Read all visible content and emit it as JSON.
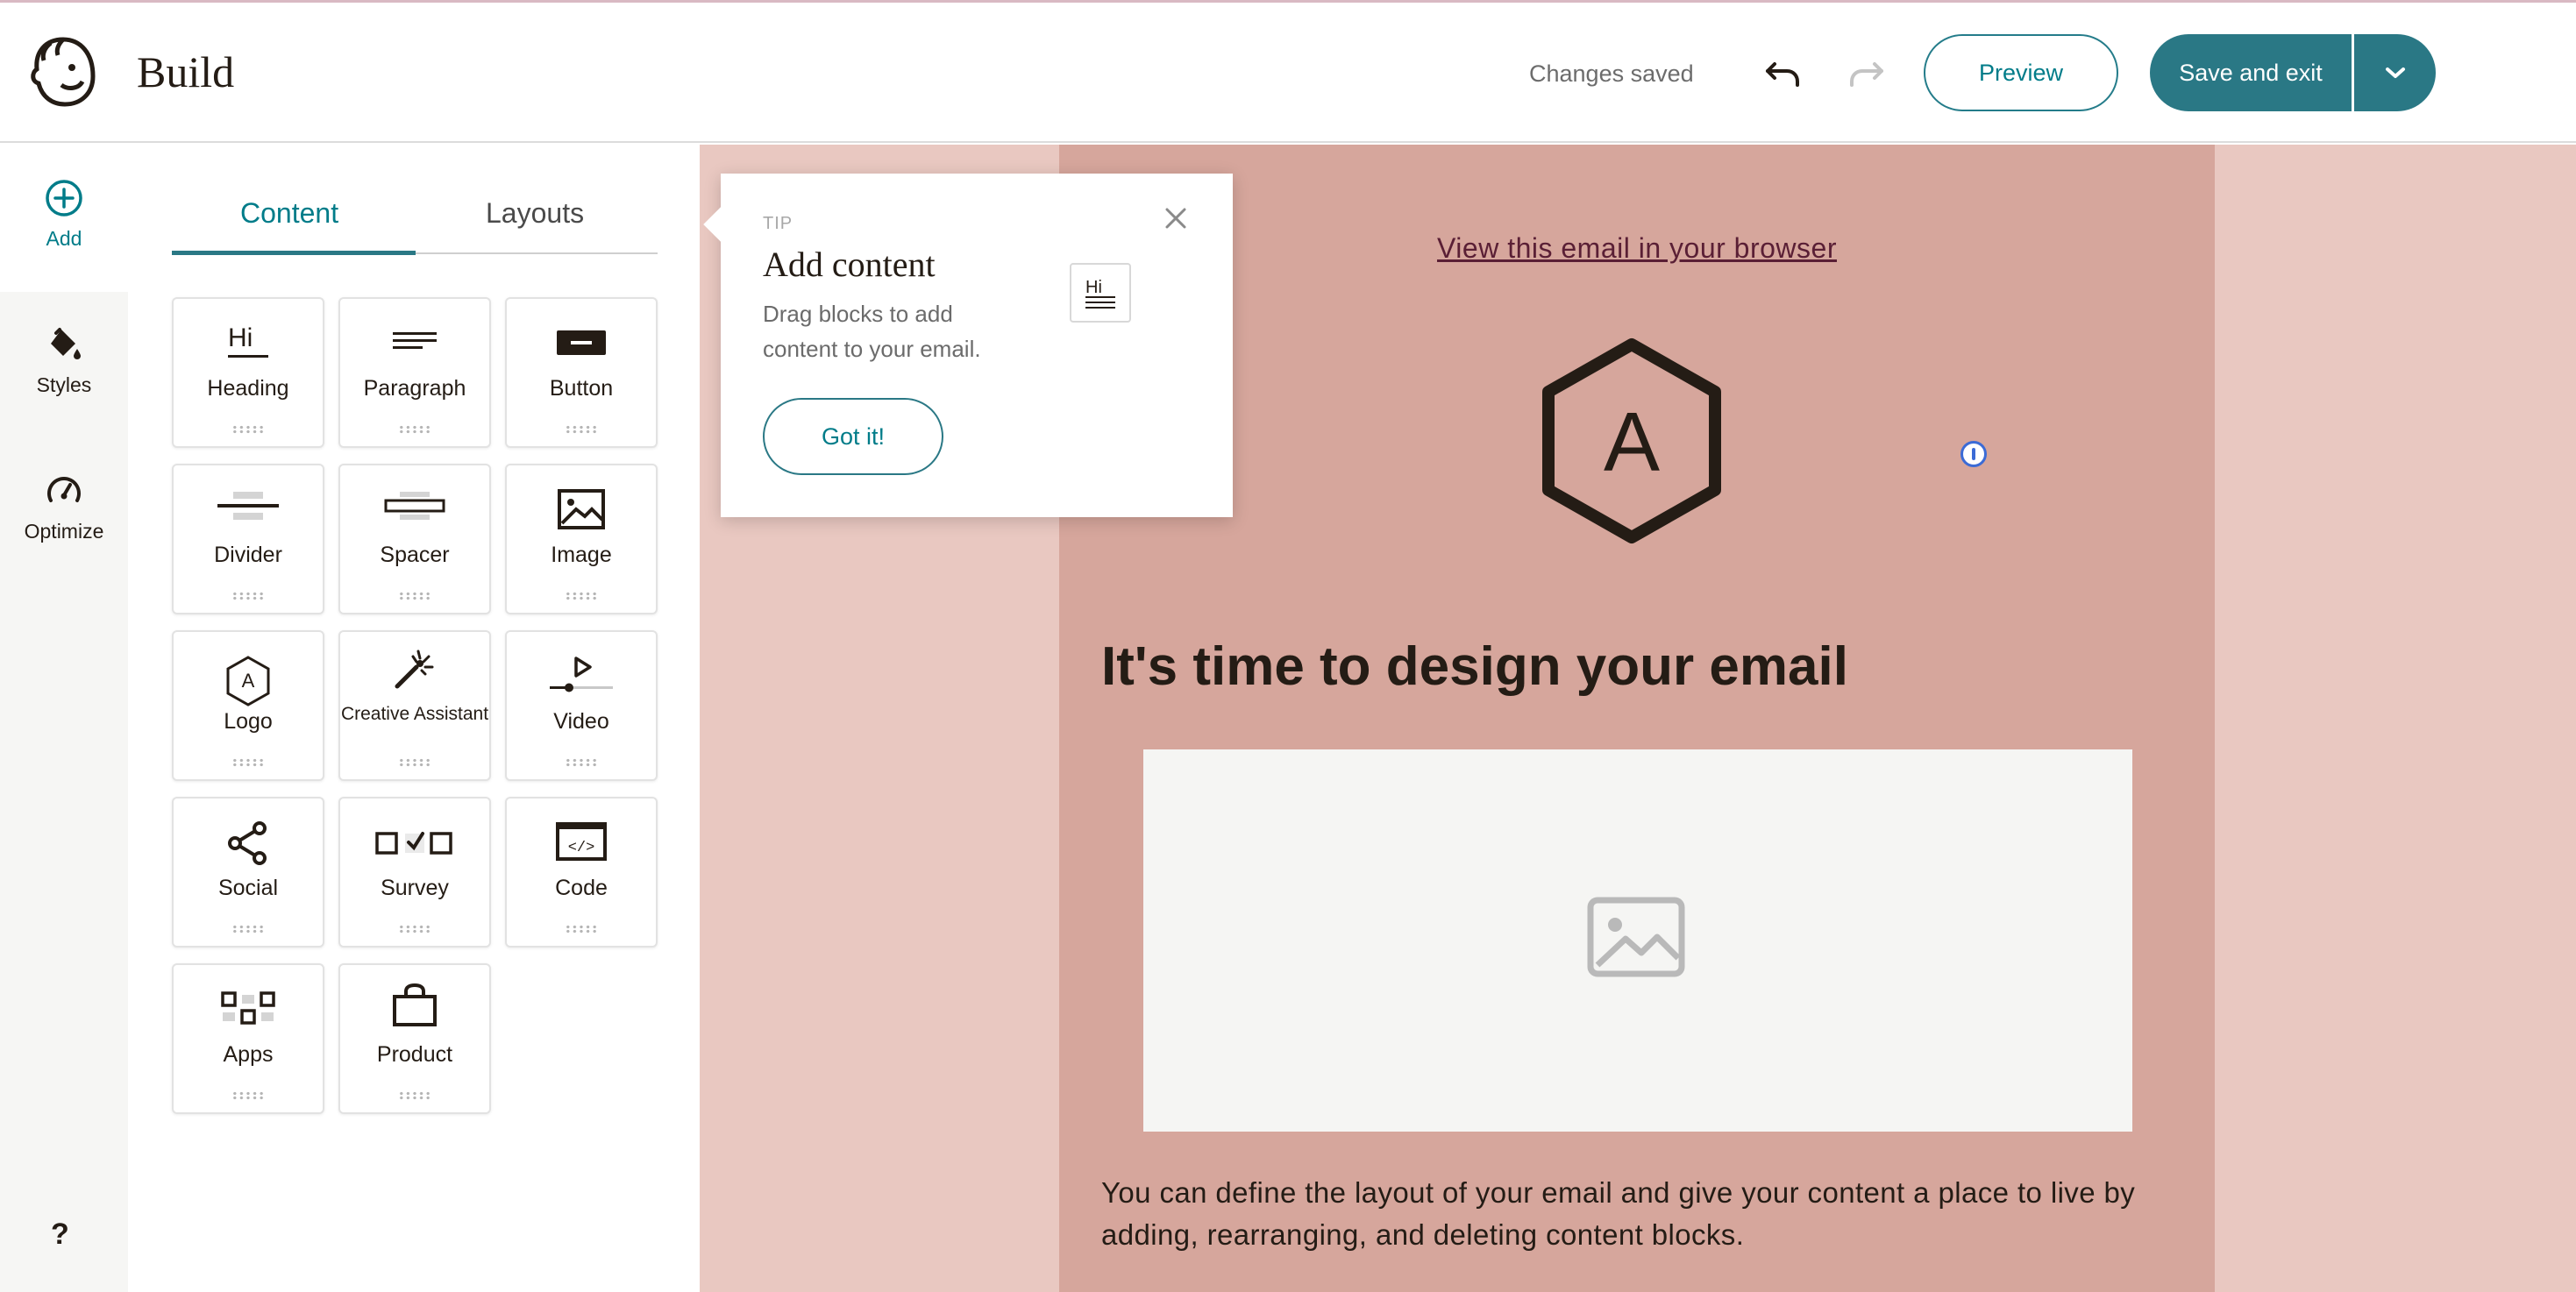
{
  "header": {
    "title": "Build",
    "status": "Changes saved",
    "preview_label": "Preview",
    "save_exit_label": "Save and exit"
  },
  "rail": {
    "add_label": "Add",
    "styles_label": "Styles",
    "optimize_label": "Optimize",
    "help_label": "?"
  },
  "panel": {
    "tabs": [
      {
        "label": "Content",
        "active": true
      },
      {
        "label": "Layouts",
        "active": false
      }
    ],
    "blocks": [
      {
        "label": "Heading",
        "icon": "heading-icon"
      },
      {
        "label": "Paragraph",
        "icon": "paragraph-icon"
      },
      {
        "label": "Button",
        "icon": "button-icon"
      },
      {
        "label": "Divider",
        "icon": "divider-icon"
      },
      {
        "label": "Spacer",
        "icon": "spacer-icon"
      },
      {
        "label": "Image",
        "icon": "image-icon"
      },
      {
        "label": "Logo",
        "icon": "logo-icon"
      },
      {
        "label": "Creative Assistant",
        "icon": "magic-wand-icon"
      },
      {
        "label": "Video",
        "icon": "video-icon"
      },
      {
        "label": "Social",
        "icon": "share-icon"
      },
      {
        "label": "Survey",
        "icon": "survey-icon"
      },
      {
        "label": "Code",
        "icon": "code-icon"
      },
      {
        "label": "Apps",
        "icon": "apps-icon"
      },
      {
        "label": "Product",
        "icon": "shopping-bag-icon"
      }
    ]
  },
  "tip": {
    "label": "TIP",
    "title": "Add content",
    "text": "Drag blocks to add content to your email.",
    "button": "Got it!",
    "thumb_text": "Hi"
  },
  "email": {
    "view_link": "View this email in your browser",
    "logo_letter": "A",
    "headline": "It's time to design your email",
    "body": "You can define the layout of your email and give your content a place to live by adding, rearranging, and deleting content blocks."
  },
  "colors": {
    "accent": "#2a7885",
    "canvas_outer": "#e9c8c1",
    "canvas_inner": "#d6a69c"
  }
}
